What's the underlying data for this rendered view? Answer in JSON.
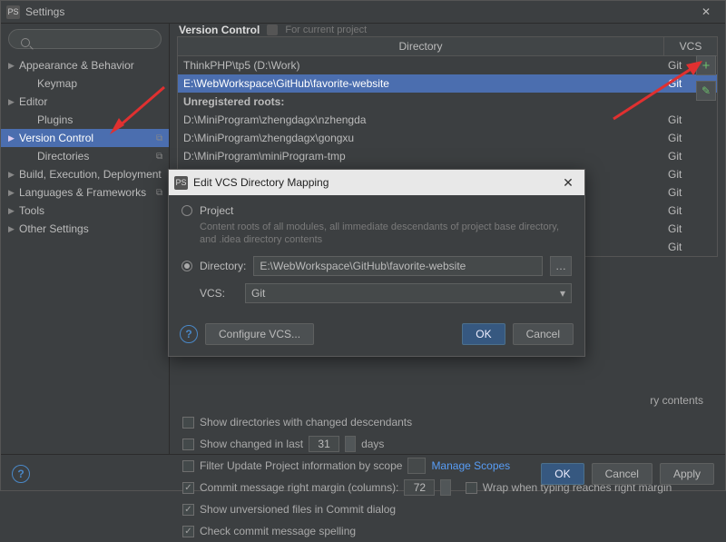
{
  "titlebar": {
    "app_icon": "PS",
    "title": "Settings"
  },
  "sidebar": {
    "items": [
      {
        "label": "Appearance & Behavior",
        "expandable": true
      },
      {
        "label": "Keymap",
        "expandable": false
      },
      {
        "label": "Editor",
        "expandable": true
      },
      {
        "label": "Plugins",
        "expandable": false,
        "child": true
      },
      {
        "label": "Version Control",
        "expandable": true,
        "selected": true,
        "tag": true
      },
      {
        "label": "Directories",
        "expandable": false,
        "child": true,
        "tag": true
      },
      {
        "label": "Build, Execution, Deployment",
        "expandable": true
      },
      {
        "label": "Languages & Frameworks",
        "expandable": true,
        "tag": true
      },
      {
        "label": "Tools",
        "expandable": true
      },
      {
        "label": "Other Settings",
        "expandable": true
      }
    ]
  },
  "crumb": {
    "title": "Version Control",
    "subtitle": "For current project"
  },
  "table": {
    "headers": {
      "dir": "Directory",
      "vcs": "VCS"
    },
    "rows": [
      {
        "dir": "ThinkPHP\\tp5 (D:\\Work)",
        "vcs": "Git"
      },
      {
        "dir": "E:\\WebWorkspace\\GitHub\\favorite-website",
        "vcs": "Git",
        "selected": true
      },
      {
        "dir": "Unregistered roots:",
        "header": true
      },
      {
        "dir": "D:\\MiniProgram\\zhengdagx\\nzhengda",
        "vcs": "Git"
      },
      {
        "dir": "D:\\MiniProgram\\zhengdagx\\gongxu",
        "vcs": "Git"
      },
      {
        "dir": "D:\\MiniProgram\\miniProgram-tmp",
        "vcs": "Git"
      },
      {
        "dir": "",
        "vcs": "Git"
      },
      {
        "dir": "",
        "vcs": "Git"
      },
      {
        "dir": "",
        "vcs": "Git"
      },
      {
        "dir": "",
        "vcs": "Git"
      },
      {
        "dir": "",
        "vcs": "Git"
      }
    ]
  },
  "options": {
    "dir_contents_hint": "ry contents",
    "show_dirs_changed": "Show directories with changed descendants",
    "show_changed_last": "Show changed in last",
    "show_changed_days_val": "31",
    "show_changed_days_unit": "days",
    "filter_update": "Filter Update Project information by scope",
    "manage_scopes": "Manage Scopes",
    "commit_margin": "Commit message right margin (columns):",
    "commit_margin_val": "72",
    "wrap_typing": "Wrap when typing reaches right margin",
    "show_unversioned": "Show unversioned files in Commit dialog",
    "check_spelling": "Check commit message spelling"
  },
  "footer": {
    "ok": "OK",
    "cancel": "Cancel",
    "apply": "Apply"
  },
  "dialog": {
    "icon": "PS",
    "title": "Edit VCS Directory Mapping",
    "project_label": "Project",
    "project_hint": "Content roots of all modules, all immediate descendants of project base directory, and .idea directory contents",
    "directory_label": "Directory:",
    "directory_value": "E:\\WebWorkspace\\GitHub\\favorite-website",
    "vcs_label": "VCS:",
    "vcs_value": "Git",
    "configure": "Configure VCS...",
    "ok": "OK",
    "cancel": "Cancel"
  }
}
